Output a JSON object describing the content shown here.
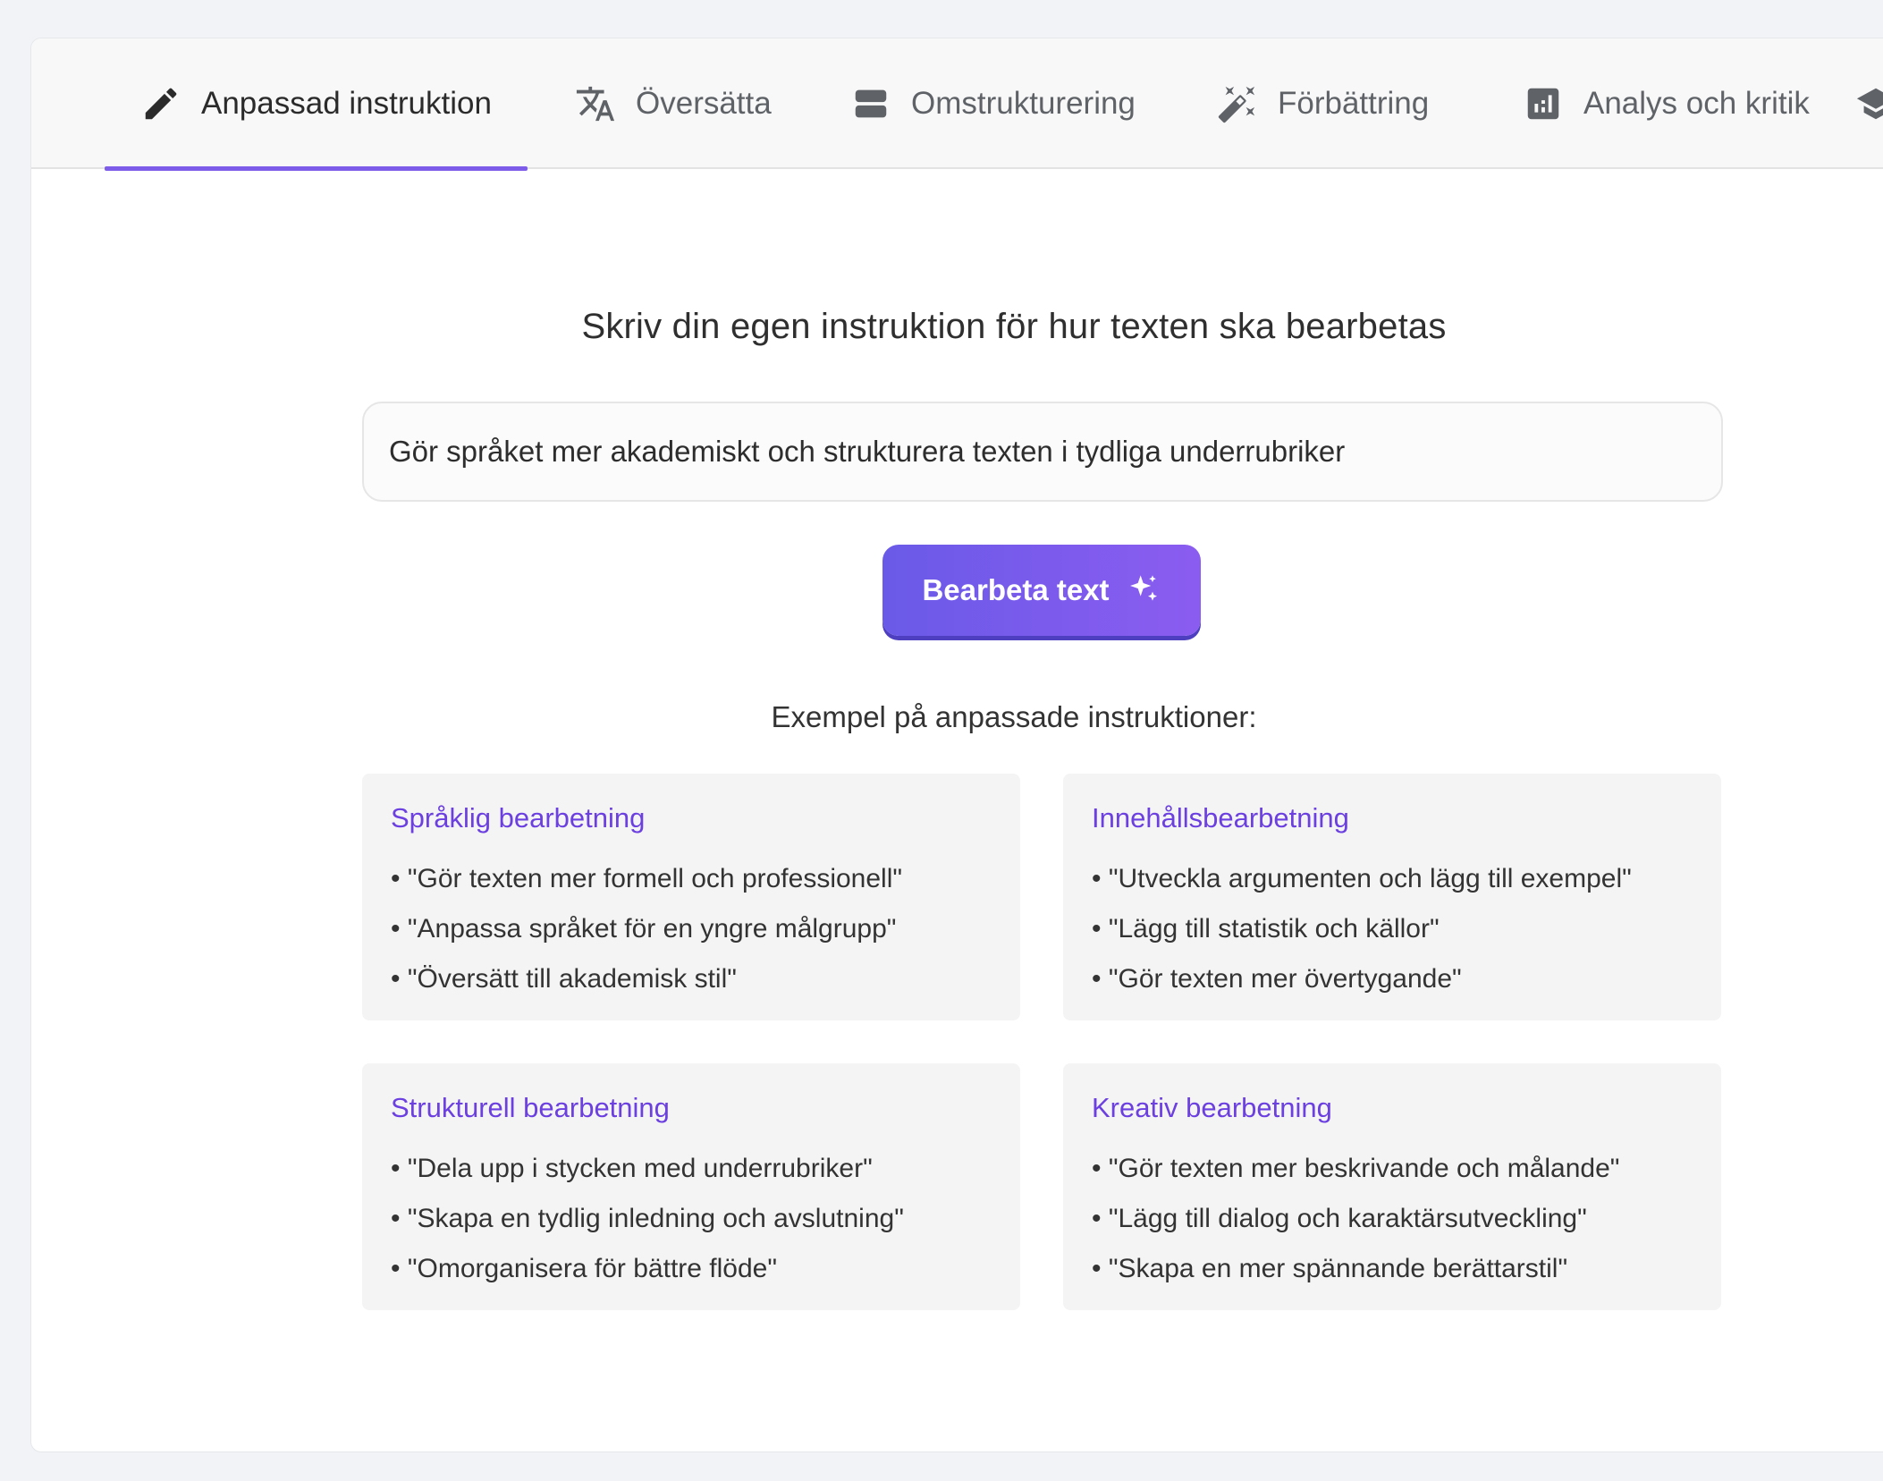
{
  "tabs": [
    {
      "label": "Anpassad instruktion",
      "icon": "pencil-icon",
      "active": true
    },
    {
      "label": "Översätta",
      "icon": "translate-icon",
      "active": false
    },
    {
      "label": "Omstrukturering",
      "icon": "restructure-icon",
      "active": false
    },
    {
      "label": "Förbättring",
      "icon": "magic-wand-icon",
      "active": false
    },
    {
      "label": "Analys och kritik",
      "icon": "analytics-icon",
      "active": false
    }
  ],
  "main": {
    "heading": "Skriv din egen instruktion för hur texten ska bearbetas",
    "instruction_value": "Gör språket mer akademiskt och strukturera texten i tydliga underrubriker",
    "process_button_label": "Bearbeta text",
    "examples_title": "Exempel på anpassade instruktioner:"
  },
  "example_cards": [
    {
      "title": "Språklig bearbetning",
      "items": [
        "\"Gör texten mer formell och professionell\"",
        "\"Anpassa språket för en yngre målgrupp\"",
        "\"Översätt till akademisk stil\""
      ]
    },
    {
      "title": "Innehållsbearbetning",
      "items": [
        "\"Utveckla argumenten och lägg till exempel\"",
        "\"Lägg till statistik och källor\"",
        "\"Gör texten mer övertygande\""
      ]
    },
    {
      "title": "Strukturell bearbetning",
      "items": [
        "\"Dela upp i stycken med underrubriker\"",
        "\"Skapa en tydlig inledning och avslutning\"",
        "\"Omorganisera för bättre flöde\""
      ]
    },
    {
      "title": "Kreativ bearbetning",
      "items": [
        "\"Gör texten mer beskrivande och målande\"",
        "\"Lägg till dialog och karaktärsutveckling\"",
        "\"Skapa en mer spännande berättarstil\""
      ]
    }
  ],
  "colors": {
    "accent": "#7c5ce8",
    "card_title": "#6b3fe0",
    "button_gradient_start": "#6a5ae8",
    "button_gradient_end": "#8b5cf0"
  }
}
